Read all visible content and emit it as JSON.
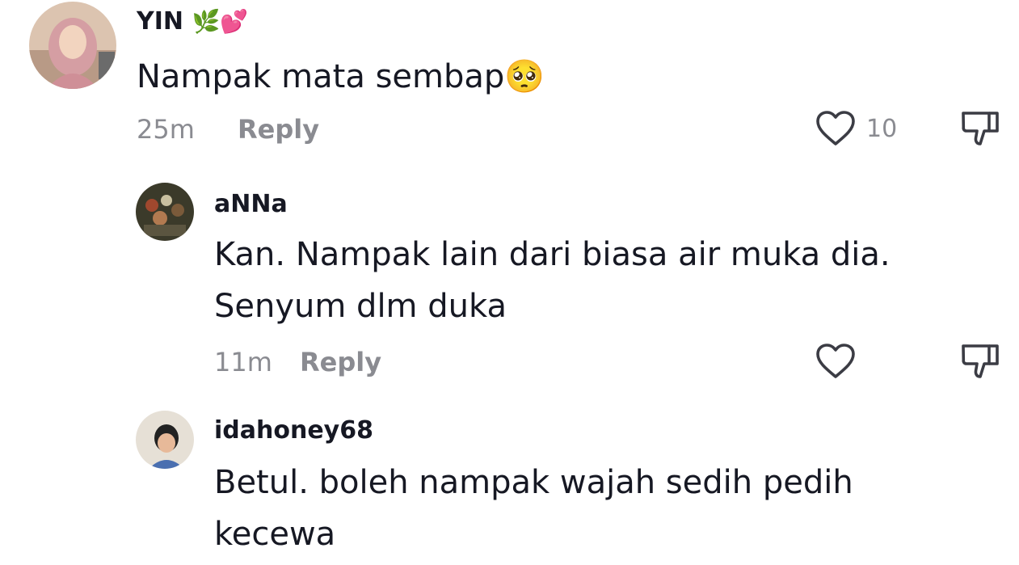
{
  "comments": [
    {
      "username": "YIN",
      "username_emojis": "🌿💕",
      "text": "Nampak mata sembap",
      "text_emoji": "🥺",
      "time": "25m",
      "reply_label": "Reply",
      "like_count": "10",
      "avatar_colors": {
        "bg": "#d8b9a3",
        "hijab": "#d7a4a7",
        "face": "#f0cfb8"
      }
    },
    {
      "username": "aNNa",
      "text_line1": "Kan. Nampak lain dari biasa air muka dia.",
      "text_line2": "Senyum dlm duka",
      "time": "11m",
      "reply_label": "Reply",
      "like_count": "",
      "avatar_colors": {
        "bg": "#3b3a2a",
        "spot1": "#a0482e",
        "spot2": "#c9c0a0"
      }
    },
    {
      "username": "idahoney68",
      "text_line1": "Betul. boleh nampak wajah sedih pedih",
      "text_line2": "kecewa",
      "avatar_colors": {
        "bg": "#e6e0d6",
        "hair": "#222222",
        "face": "#e7b999",
        "shirt": "#4a6fb0"
      }
    }
  ],
  "icons": {
    "like": "heart-outline-icon",
    "dislike": "thumbs-down-outline-icon"
  },
  "colors": {
    "text": "#161823",
    "meta": "#8a8b91"
  }
}
